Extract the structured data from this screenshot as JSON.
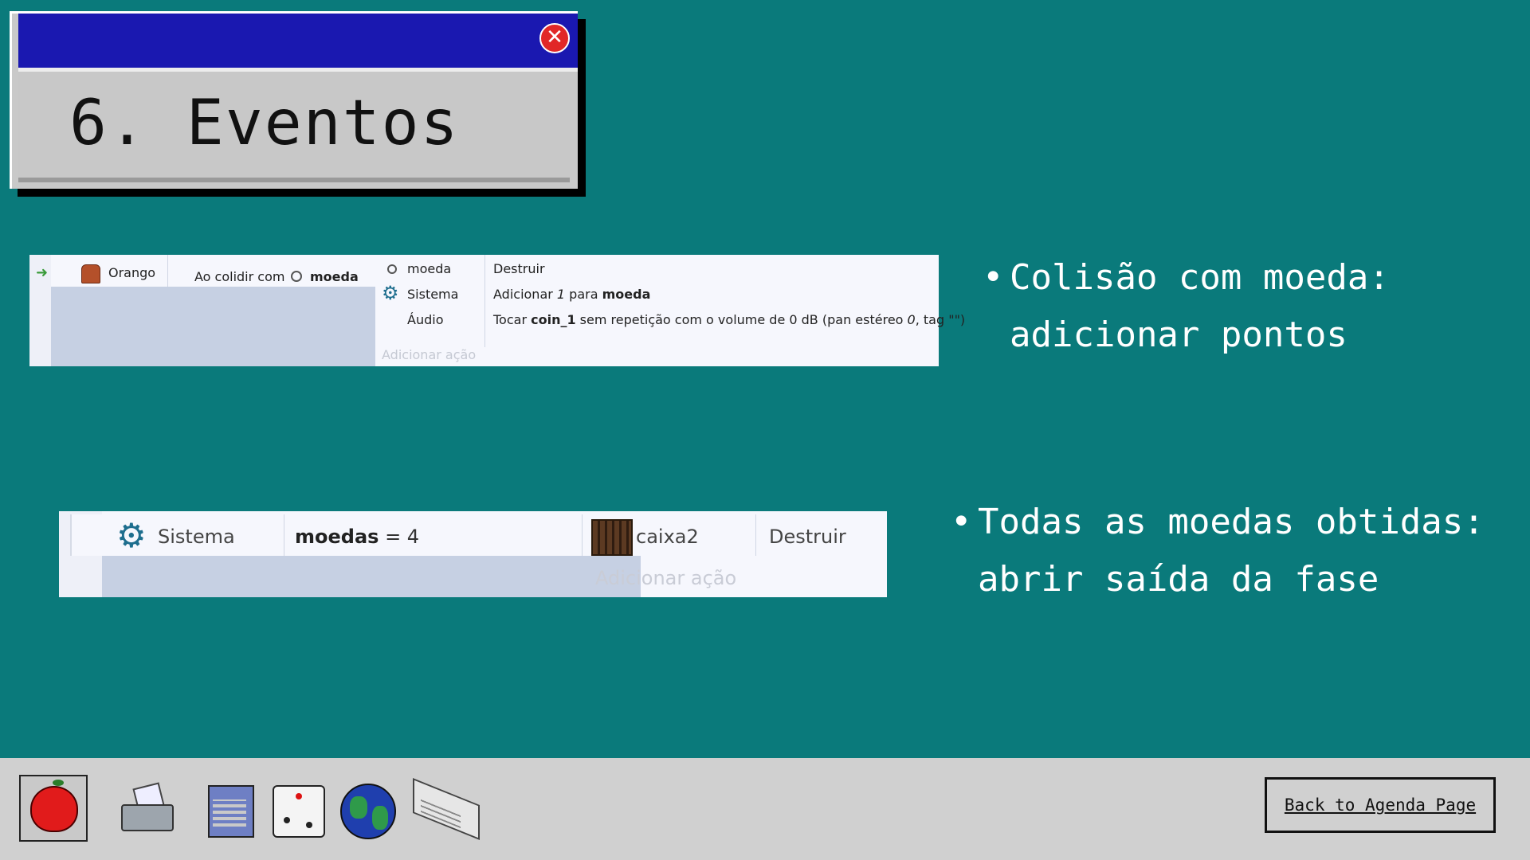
{
  "title_window": {
    "title": "6. Eventos",
    "close_icon": "close-icon"
  },
  "event1": {
    "condition_object": "Orango",
    "condition_text": "Ao colidir com",
    "condition_target": "moeda",
    "actions": [
      {
        "object": "moeda",
        "icon": "coin-icon",
        "text_parts": [
          "Destruir"
        ]
      },
      {
        "object": "Sistema",
        "icon": "gear-icon",
        "text_parts": [
          "Adicionar ",
          "1",
          " para ",
          "moeda"
        ]
      },
      {
        "object": "Áudio",
        "icon": "",
        "text_parts": [
          "Tocar ",
          "coin_1",
          " sem repetição com o volume de 0 dB (pan estéreo ",
          "0",
          ", tag \"\")"
        ]
      }
    ],
    "add_action": "Adicionar ação"
  },
  "event2": {
    "condition_object": "Sistema",
    "condition_var": "moedas",
    "condition_rest": " = 4",
    "action_object": "caixa2",
    "action_text": "Destruir",
    "add_action": "Adicionar ação"
  },
  "bullets": [
    {
      "line1": "Colisão com moeda:",
      "line2": "adicionar pontos"
    },
    {
      "line1": "Todas as moedas obtidas:",
      "line2": "abrir saída da fase"
    }
  ],
  "taskbar": {
    "icons": [
      "apple-icon",
      "printer-icon",
      "notepad-icon",
      "dice-icon",
      "globe-icon",
      "book-icon"
    ],
    "back_button": "Back to Agenda Page"
  },
  "colors": {
    "background": "#0a7a7b",
    "title_bar": "#1a18b0",
    "taskbar": "#d0d0d0"
  }
}
